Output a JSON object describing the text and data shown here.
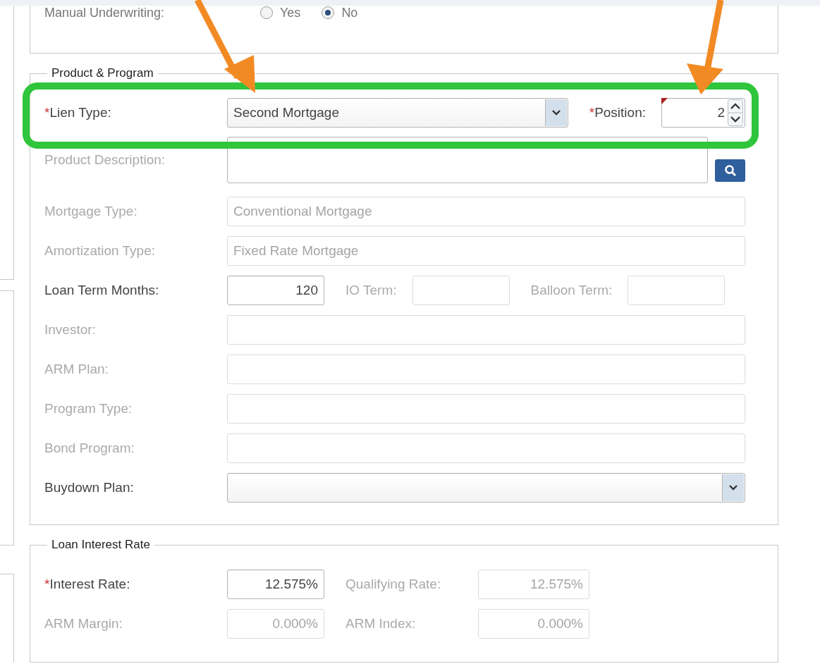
{
  "manual_underwriting": {
    "label": "Manual Underwriting:",
    "options": [
      {
        "label": "Yes",
        "selected": false
      },
      {
        "label": "No",
        "selected": true
      }
    ]
  },
  "product_program": {
    "title": "Product & Program",
    "rows": [
      {
        "items": [
          {
            "kind": "label",
            "mark": "*",
            "text": "Lien Type:",
            "disabled": false
          },
          {
            "kind": "select",
            "value": "Second Mortgage"
          },
          {
            "kind": "inline-label",
            "mark": "*",
            "text": "Position:",
            "disabled": false
          },
          {
            "kind": "spinner",
            "value": "2",
            "changed": true
          }
        ]
      },
      {
        "items": [
          {
            "kind": "label",
            "text": "Product Description:",
            "disabled": true
          },
          {
            "kind": "search-area"
          }
        ]
      },
      {
        "items": [
          {
            "kind": "label",
            "text": "Mortgage Type:",
            "disabled": true
          },
          {
            "kind": "text",
            "value": "Conventional Mortgage",
            "disabled": true
          }
        ]
      },
      {
        "items": [
          {
            "kind": "label",
            "text": "Amortization Type:",
            "disabled": true
          },
          {
            "kind": "text",
            "value": "Fixed Rate Mortgage",
            "disabled": true
          }
        ]
      },
      {
        "items": [
          {
            "kind": "label",
            "text": "Loan Term Months:",
            "disabled": false
          },
          {
            "kind": "short-text",
            "value": "120",
            "disabled": false
          },
          {
            "kind": "inline-label",
            "text": "IO Term:",
            "disabled": true
          },
          {
            "kind": "short-text",
            "disabled": true
          },
          {
            "kind": "inline-label",
            "text": "Balloon Term:",
            "disabled": true
          },
          {
            "kind": "short-text",
            "disabled": true
          }
        ]
      },
      {
        "items": [
          {
            "kind": "label",
            "text": "Investor:",
            "disabled": true
          },
          {
            "kind": "text",
            "disabled": true
          }
        ]
      },
      {
        "items": [
          {
            "kind": "label",
            "text": "ARM Plan:",
            "disabled": true
          },
          {
            "kind": "text",
            "disabled": true
          }
        ]
      },
      {
        "items": [
          {
            "kind": "label",
            "text": "Program Type:",
            "disabled": true
          },
          {
            "kind": "text",
            "disabled": true
          }
        ]
      },
      {
        "items": [
          {
            "kind": "label",
            "text": "Bond Program:",
            "disabled": true
          },
          {
            "kind": "text",
            "disabled": true
          }
        ]
      },
      {
        "items": [
          {
            "kind": "label",
            "text": "Buydown Plan:",
            "disabled": false
          },
          {
            "kind": "select"
          }
        ]
      }
    ]
  },
  "loan_interest_rate": {
    "title": "Loan Interest Rate",
    "rows": [
      {
        "items": [
          {
            "kind": "label",
            "mark": "*",
            "text": "Interest Rate:",
            "disabled": false
          },
          {
            "kind": "short-text",
            "value": "12.575%",
            "disabled": false
          },
          {
            "kind": "inline-label",
            "text": "Qualifying Rate:",
            "disabled": true
          },
          {
            "kind": "rate-text",
            "value": "12.575%",
            "disabled": true
          }
        ]
      },
      {
        "items": [
          {
            "kind": "label",
            "text": "ARM Margin:",
            "disabled": true
          },
          {
            "kind": "short-text",
            "value": "0.000%",
            "disabled": true
          },
          {
            "kind": "inline-label",
            "text": "ARM Index:",
            "disabled": true
          },
          {
            "kind": "rate-text",
            "value": "0.000%",
            "disabled": true
          }
        ]
      }
    ]
  }
}
